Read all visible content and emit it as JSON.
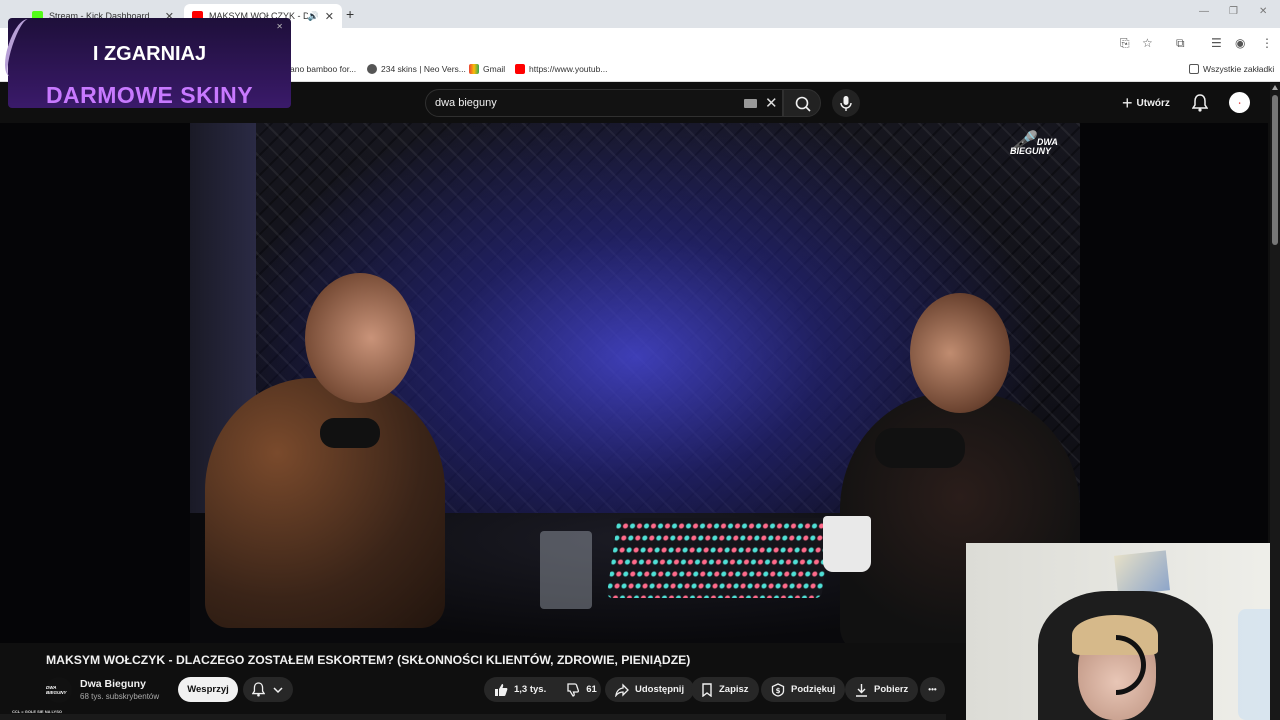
{
  "browser": {
    "tabs": [
      {
        "title": "Stream - Kick Dashboard",
        "favicon_color": "#53fc18"
      },
      {
        "title": "MAKSYM WOŁCZYK - DLACZ",
        "favicon_color": "#ff0000",
        "active": true
      }
    ],
    "bookmarks": [
      {
        "label": "ano bamboo for...",
        "icon": "bamboo-icon"
      },
      {
        "label": "234 skins | Neo Vers...",
        "icon": "globe-icon"
      },
      {
        "label": "Gmail",
        "icon": "gmail-icon"
      },
      {
        "label": "https://www.youtub...",
        "icon": "youtube-icon"
      }
    ],
    "all_bookmarks_label": "Wszystkie zakładki"
  },
  "youtube": {
    "search_query": "dwa bieguny",
    "create_label": "Utwórz",
    "video": {
      "title": "MAKSYM WOŁCZYK - DLACZEGO ZOSTAŁEM ESKORTEM? (SKŁONNOŚCI KLIENTÓW, ZDROWIE, PIENIĄDZE)",
      "watermark": [
        "DWA",
        "BIEGUNY"
      ]
    },
    "channel": {
      "name": "Dwa Bieguny",
      "subscribers": "68 tys. subskrybentów",
      "avatar_text": "DWA BIEGUNY"
    },
    "actions": {
      "support": "Wesprzyj",
      "likes": "1,3 tys.",
      "dislikes": "61",
      "share": "Udostępnij",
      "save": "Zapisz",
      "thanks": "Podziękuj",
      "download": "Pobierz",
      "more": "•••"
    }
  },
  "overlay": {
    "promo_line1": "I ZGARNIAJ",
    "promo_line2": "DARMOWE SKINY",
    "cam_caption": "CCL = GOLE SIE NA LYSO",
    "accent": "#c879ff"
  },
  "colors": {
    "youtube_bg": "#0f0f0f",
    "pill_bg": "#272727",
    "text": "#f1f1f1"
  }
}
